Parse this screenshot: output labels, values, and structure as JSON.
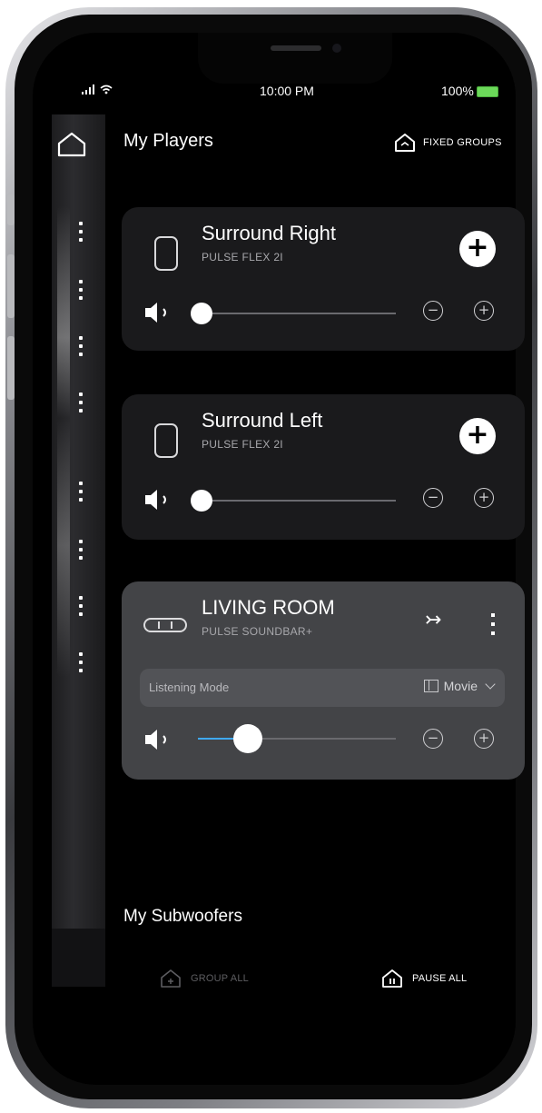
{
  "status_bar": {
    "time": "10:00 PM",
    "battery": "100%"
  },
  "header": {
    "title": "My Players",
    "fixed_groups_label": "FIXED GROUPS"
  },
  "players": [
    {
      "name": "Surround Right",
      "model": "PULSE FLEX 2I",
      "volume": 0.1
    },
    {
      "name": "Surround Left",
      "model": "PULSE FLEX 2I",
      "volume": 0.1
    },
    {
      "name": "LIVING ROOM",
      "model": "PULSE SOUNDBAR+",
      "volume": 0.25,
      "listening_mode_label": "Listening Mode",
      "listening_mode_value": "Movie"
    }
  ],
  "subwoofers": {
    "title": "My Subwoofers"
  },
  "footer": {
    "group_all_label": "GROUP ALL",
    "pause_all_label": "PAUSE ALL"
  },
  "colors": {
    "accent": "#3fa9f5",
    "card": "#1a1a1c",
    "active_card": "#434447",
    "battery": "#6cd95a"
  },
  "icons": [
    "home-icon",
    "speaker-icon",
    "plus-icon",
    "minus-icon",
    "soundbar-icon",
    "group-arrow-icon",
    "more-icon",
    "film-icon",
    "chevron-down-icon",
    "house-icon"
  ]
}
